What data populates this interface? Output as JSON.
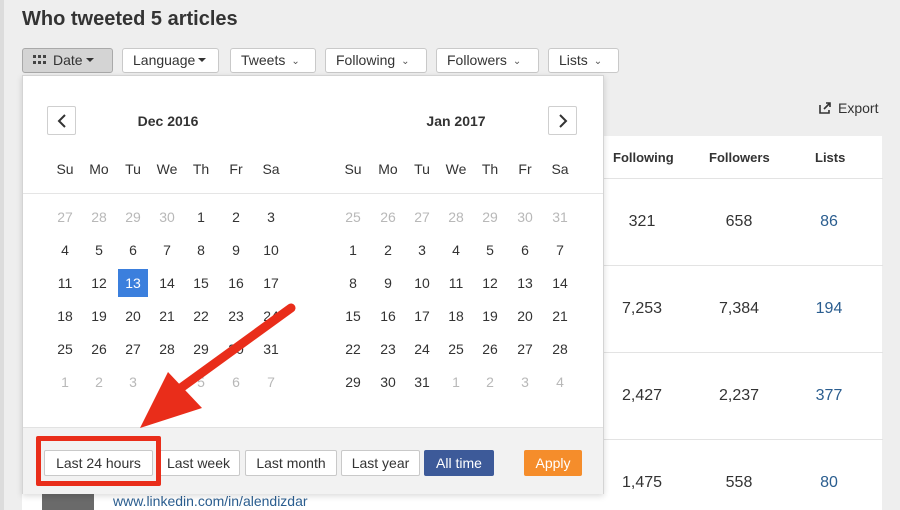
{
  "page": {
    "title": "Who tweeted 5 articles"
  },
  "filters": [
    {
      "label": "Date",
      "style": "caret"
    },
    {
      "label": "Language",
      "style": "caret"
    },
    {
      "label": "Tweets",
      "style": "chevron"
    },
    {
      "label": "Following",
      "style": "chevron"
    },
    {
      "label": "Followers",
      "style": "chevron"
    },
    {
      "label": "Lists",
      "style": "chevron"
    }
  ],
  "export": {
    "label": "Export"
  },
  "table": {
    "headers": [
      "Following",
      "Followers",
      "Lists"
    ],
    "rows": [
      {
        "following": "321",
        "followers": "658",
        "lists": "86"
      },
      {
        "following": "7,253",
        "followers": "7,384",
        "lists": "194"
      },
      {
        "following": "2,427",
        "followers": "2,237",
        "lists": "377"
      },
      {
        "following": "1,475",
        "followers": "558",
        "lists": "80"
      }
    ]
  },
  "profile_link": "www.linkedin.com/in/alendizdar",
  "datepicker": {
    "weekdays": [
      "Su",
      "Mo",
      "Tu",
      "We",
      "Th",
      "Fr",
      "Sa"
    ],
    "months": [
      {
        "title": "Dec 2016",
        "days": [
          [
            "27",
            "28",
            "29",
            "30",
            "1",
            "2",
            "3"
          ],
          [
            "4",
            "5",
            "6",
            "7",
            "8",
            "9",
            "10"
          ],
          [
            "11",
            "12",
            "13",
            "14",
            "15",
            "16",
            "17"
          ],
          [
            "18",
            "19",
            "20",
            "21",
            "22",
            "23",
            "24"
          ],
          [
            "25",
            "26",
            "27",
            "28",
            "29",
            "30",
            "31"
          ],
          [
            "1",
            "2",
            "3",
            "4",
            "5",
            "6",
            "7"
          ]
        ],
        "muted": [
          [
            0,
            0
          ],
          [
            0,
            1
          ],
          [
            0,
            2
          ],
          [
            0,
            3
          ],
          [
            5,
            0
          ],
          [
            5,
            1
          ],
          [
            5,
            2
          ],
          [
            5,
            3
          ],
          [
            5,
            4
          ],
          [
            5,
            5
          ],
          [
            5,
            6
          ]
        ],
        "selected": [
          2,
          2
        ]
      },
      {
        "title": "Jan 2017",
        "days": [
          [
            "25",
            "26",
            "27",
            "28",
            "29",
            "30",
            "31"
          ],
          [
            "1",
            "2",
            "3",
            "4",
            "5",
            "6",
            "7"
          ],
          [
            "8",
            "9",
            "10",
            "11",
            "12",
            "13",
            "14"
          ],
          [
            "15",
            "16",
            "17",
            "18",
            "19",
            "20",
            "21"
          ],
          [
            "22",
            "23",
            "24",
            "25",
            "26",
            "27",
            "28"
          ],
          [
            "29",
            "30",
            "31",
            "1",
            "2",
            "3",
            "4"
          ]
        ],
        "muted": [
          [
            0,
            0
          ],
          [
            0,
            1
          ],
          [
            0,
            2
          ],
          [
            0,
            3
          ],
          [
            0,
            4
          ],
          [
            0,
            5
          ],
          [
            0,
            6
          ],
          [
            5,
            3
          ],
          [
            5,
            4
          ],
          [
            5,
            5
          ],
          [
            5,
            6
          ]
        ],
        "selected": null
      }
    ],
    "quick_ranges": [
      {
        "label": "Last 24 hours"
      },
      {
        "label": "Last week"
      },
      {
        "label": "Last month"
      },
      {
        "label": "Last year"
      },
      {
        "label": "All time",
        "primary": true
      }
    ],
    "apply_label": "Apply"
  },
  "colors": {
    "accent": "#3b7fdd",
    "primary_button": "#3d5a99",
    "apply_button": "#f58d2b",
    "annotation": "#e92d1a",
    "link": "#2a5d8f"
  },
  "annotation": {
    "target": "Last 24 hours"
  }
}
